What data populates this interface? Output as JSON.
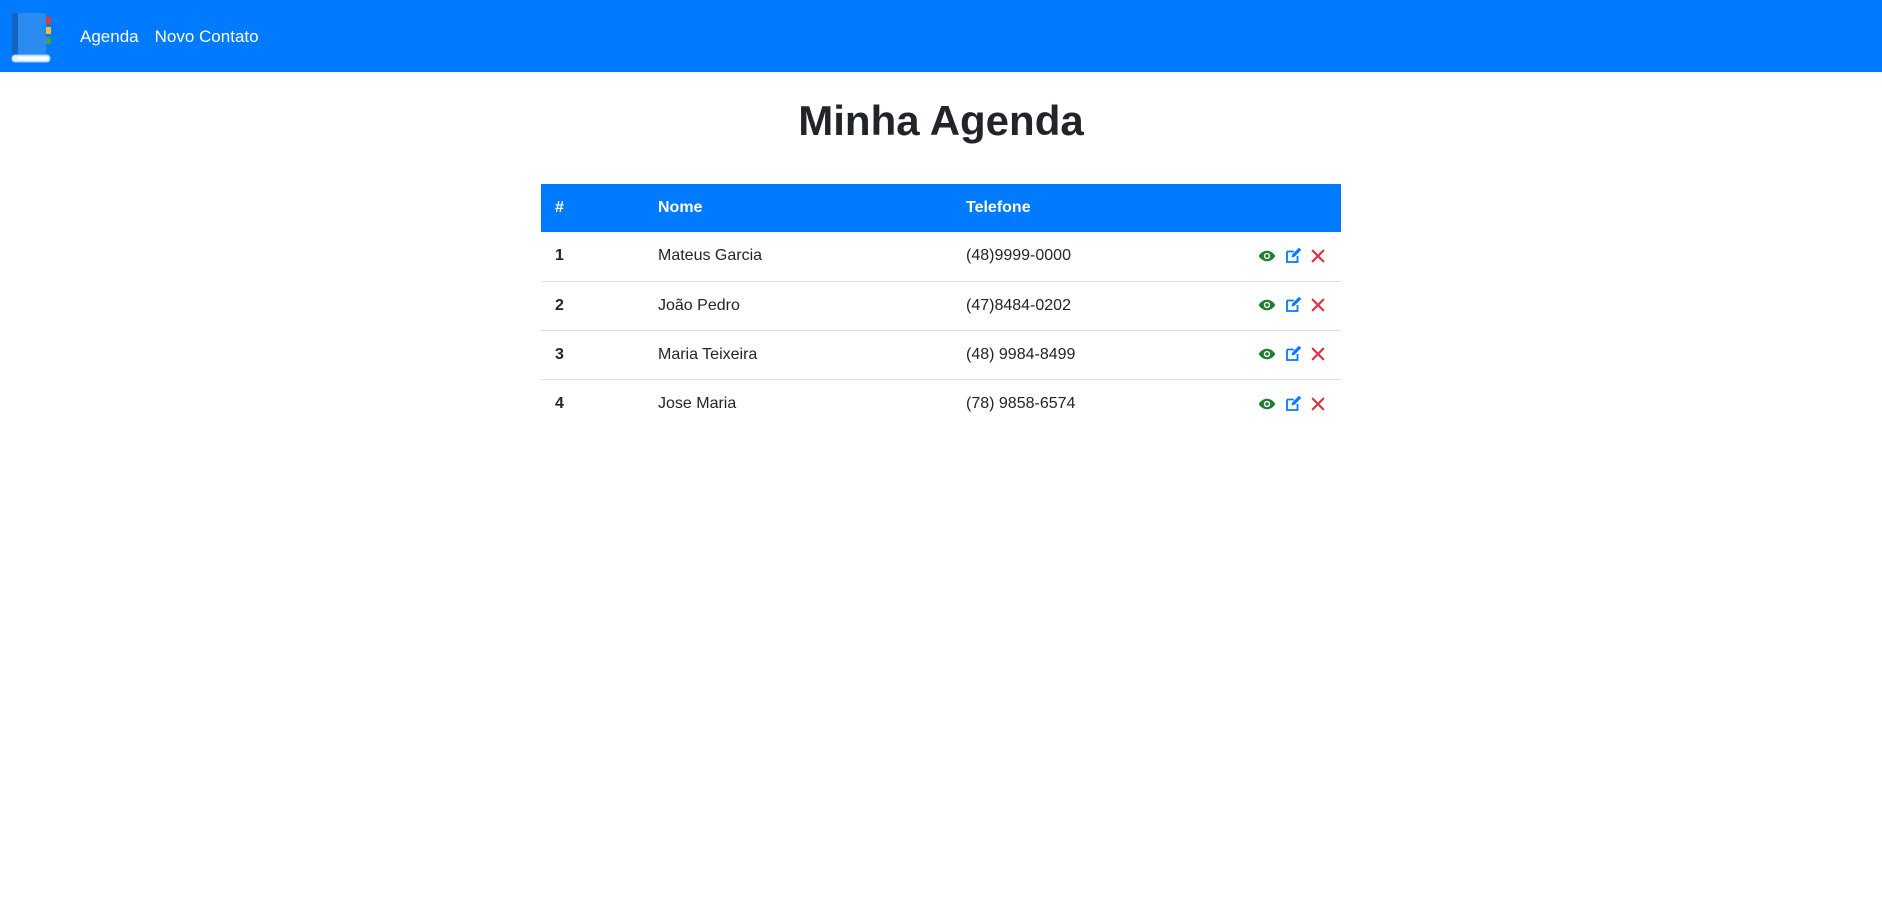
{
  "nav": {
    "logo_icon": "address-book-icon",
    "links": [
      "Agenda",
      "Novo Contato"
    ]
  },
  "page": {
    "title": "Minha Agenda"
  },
  "table": {
    "headers": {
      "index": "#",
      "name": "Nome",
      "phone": "Telefone"
    },
    "rows": [
      {
        "index": "1",
        "name": "Mateus Garcia",
        "phone": "(48)9999-0000"
      },
      {
        "index": "2",
        "name": "João Pedro",
        "phone": "(47)8484-0202"
      },
      {
        "index": "3",
        "name": "Maria Teixeira",
        "phone": "(48) 9984-8499"
      },
      {
        "index": "4",
        "name": "Jose Maria",
        "phone": "(78) 9858-6574"
      }
    ],
    "actions": [
      "eye-icon",
      "edit-icon",
      "close-icon"
    ]
  },
  "colors": {
    "primary": "#007bff",
    "view": "#28a745",
    "edit": "#007bff",
    "delete": "#dc3545",
    "text": "#212529"
  }
}
